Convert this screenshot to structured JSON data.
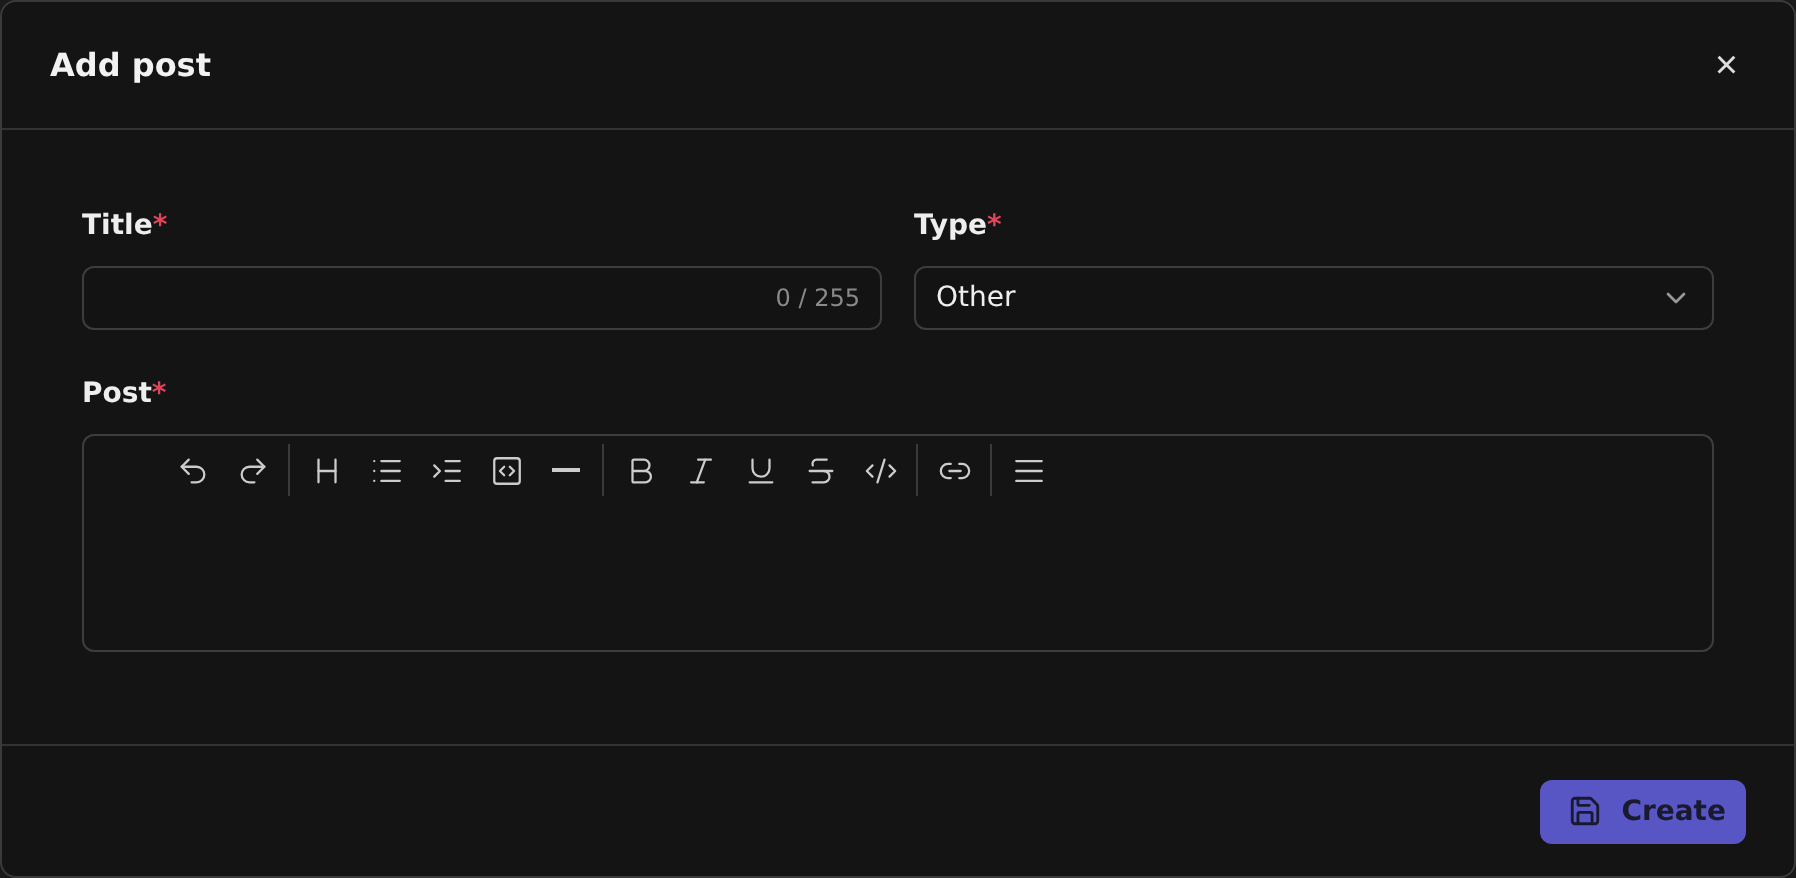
{
  "dialog": {
    "title": "Add post",
    "close": "×"
  },
  "fields": [
    {
      "kind": "text",
      "label": "Title",
      "asterisk": "*",
      "counter": "0 / 255"
    },
    {
      "kind": "select",
      "label": "Type",
      "asterisk": "*",
      "value": "Other"
    }
  ],
  "editor": {
    "label": "Post",
    "asterisk": "*"
  },
  "footer": {
    "button": "Create"
  }
}
